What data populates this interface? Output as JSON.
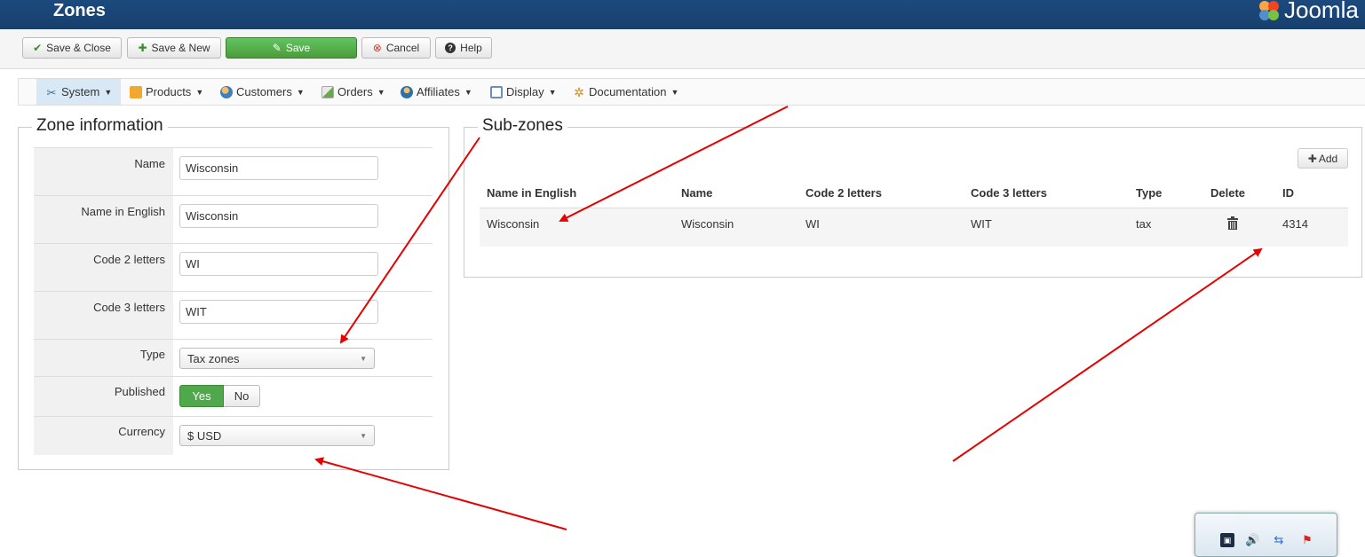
{
  "header": {
    "title": "Zones",
    "brand": "Joomla"
  },
  "toolbar": {
    "save_close": "Save & Close",
    "save_new": "Save & New",
    "save": "Save",
    "cancel": "Cancel",
    "help": "Help"
  },
  "menu": {
    "items": [
      {
        "label": "System",
        "icon": "tools-icon"
      },
      {
        "label": "Products",
        "icon": "box-icon"
      },
      {
        "label": "Customers",
        "icon": "users-icon"
      },
      {
        "label": "Orders",
        "icon": "orders-icon"
      },
      {
        "label": "Affiliates",
        "icon": "affiliates-icon"
      },
      {
        "label": "Display",
        "icon": "display-icon"
      },
      {
        "label": "Documentation",
        "icon": "documentation-icon"
      }
    ]
  },
  "zone_info": {
    "legend": "Zone information",
    "name_label": "Name",
    "name_value": "Wisconsin",
    "name_en_label": "Name in English",
    "name_en_value": "Wisconsin",
    "code2_label": "Code 2 letters",
    "code2_value": "WI",
    "code3_label": "Code 3 letters",
    "code3_value": "WIT",
    "type_label": "Type",
    "type_value": "Tax zones",
    "published_label": "Published",
    "published_yes": "Yes",
    "published_no": "No",
    "currency_label": "Currency",
    "currency_value": "$ USD"
  },
  "subzones": {
    "legend": "Sub-zones",
    "add_label": "Add",
    "columns": [
      "Name in English",
      "Name",
      "Code 2 letters",
      "Code 3 letters",
      "Type",
      "Delete",
      "ID"
    ],
    "rows": [
      {
        "name_en": "Wisconsin",
        "name": "Wisconsin",
        "code2": "WI",
        "code3": "WIT",
        "type": "tax",
        "id": "4314"
      }
    ]
  },
  "colors": {
    "header_bg": "#1c4a7d",
    "save_green": "#4fa84a",
    "annotation_red": "#e60000"
  }
}
